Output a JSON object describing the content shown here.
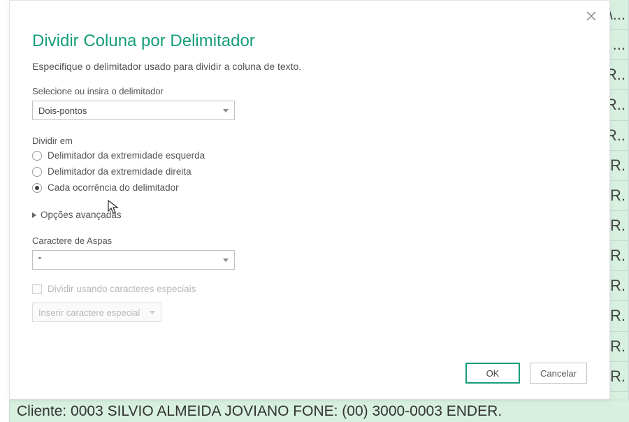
{
  "background": {
    "cells": [
      "\\...",
      "...",
      "ER..",
      "ER..",
      "ER..",
      "ER.",
      "ER.",
      "R.",
      "R.",
      "R.",
      "R.",
      "R.",
      "R.",
      "R."
    ],
    "bottomRowText": "Cliente: 0003 SILVIO ALMEIDA JOVIANO FONE: (00) 3000-0003  ENDER."
  },
  "dialog": {
    "title": "Dividir Coluna por Delimitador",
    "subtitle": "Especifique o delimitador usado para dividir a coluna de texto.",
    "delimiter": {
      "label": "Selecione ou insira o delimitador",
      "selected": "Dois-pontos"
    },
    "splitAt": {
      "groupLabel": "Dividir em",
      "options": [
        {
          "label": "Delimitador da extremidade esquerda",
          "selected": false
        },
        {
          "label": "Delimitador da extremidade direita",
          "selected": false
        },
        {
          "label": "Cada ocorrência do delimitador",
          "selected": true
        }
      ]
    },
    "advanced": {
      "label": "Opções avançadas"
    },
    "quote": {
      "label": "Caractere de Aspas",
      "selected": "\""
    },
    "special": {
      "checkboxLabel": "Dividir usando caracteres especiais",
      "insertLabel": "Inserir caractere especial"
    },
    "buttons": {
      "ok": "OK",
      "cancel": "Cancelar"
    }
  }
}
